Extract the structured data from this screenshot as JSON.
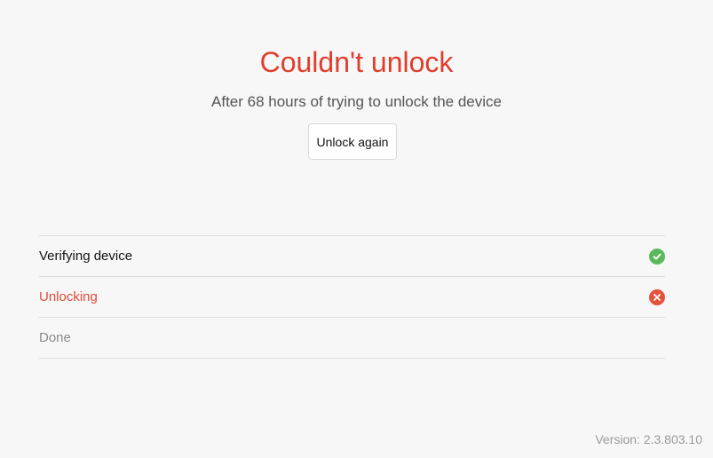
{
  "header": {
    "title": "Couldn't unlock",
    "subtitle": "After 68 hours of trying to unlock the device",
    "retry_label": "Unlock again"
  },
  "steps": [
    {
      "label": "Verifying device",
      "status": "done",
      "icon": "check-circle-icon"
    },
    {
      "label": "Unlocking",
      "status": "failed",
      "icon": "error-circle-icon"
    },
    {
      "label": "Done",
      "status": "pending",
      "icon": ""
    }
  ],
  "footer": {
    "version": "Version: 2.3.803.10"
  },
  "colors": {
    "error": "#e03e2d",
    "success": "#5cb85c"
  }
}
